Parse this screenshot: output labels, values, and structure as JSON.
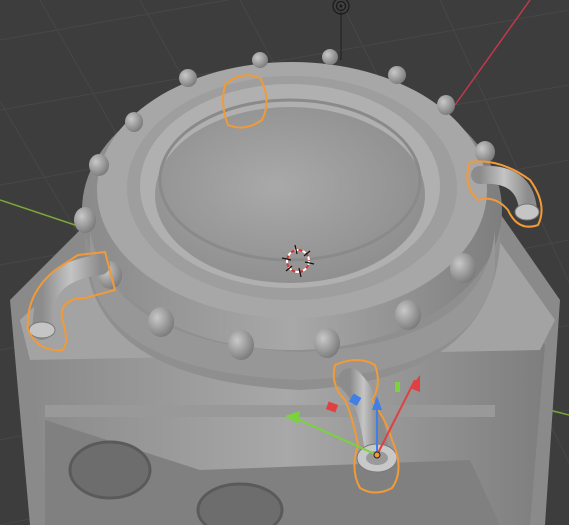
{
  "viewport": {
    "colors": {
      "background": "#3d3d3d",
      "grid": "#474747",
      "axis_x": "#c0394b",
      "axis_y": "#7ea53a",
      "selection": "#f29a38",
      "gizmo_x": "#e0403f",
      "gizmo_y": "#7ad33d",
      "gizmo_z": "#3f7fe6",
      "mesh_light": "#b4b4b4",
      "mesh_mid": "#9a9a9a",
      "mesh_dark": "#6e6e6e"
    },
    "icons": {
      "camera": "camera-icon",
      "light": "light-icon",
      "cursor": "3d-cursor-icon",
      "origin": "object-origin-icon"
    },
    "selected_objects": [
      "selected-pipe-front",
      "selected-pipe-left",
      "selected-pipe-right",
      "selected-rim-patch"
    ]
  }
}
